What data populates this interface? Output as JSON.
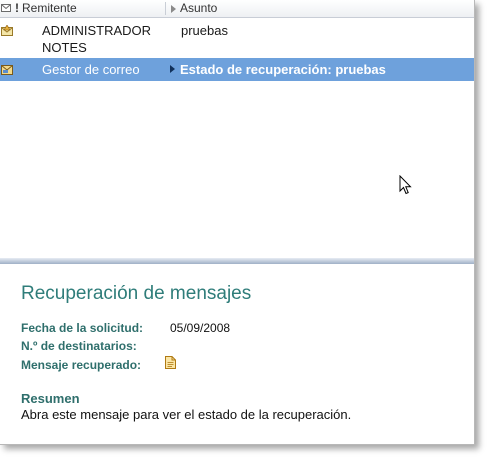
{
  "columns": {
    "sender": "Remitente",
    "subject": "Asunto",
    "importance_mark": "!"
  },
  "messages": [
    {
      "from": "ADMINISTRADOR NOTES",
      "subject": "pruebas",
      "icon": "envelope-warning-icon",
      "selected": false
    },
    {
      "from": "Gestor de correo",
      "subject": "Estado de recuperación: pruebas",
      "icon": "recall-envelope-icon",
      "selected": true
    }
  ],
  "preview": {
    "title": "Recuperación de mensajes",
    "fields": [
      {
        "label": "Fecha de la solicitud:",
        "value": "05/09/2008"
      },
      {
        "label": "N.º de destinatarios:",
        "value": ""
      },
      {
        "label": "Mensaje recuperado:",
        "value": ""
      }
    ],
    "recovered_icon": "document-icon",
    "summary_heading": "Resumen",
    "summary_text": "Abra este mensaje para ver el estado de la recuperación."
  },
  "colors": {
    "selection": "#6ea1dc",
    "heading": "#2f7d7a"
  }
}
